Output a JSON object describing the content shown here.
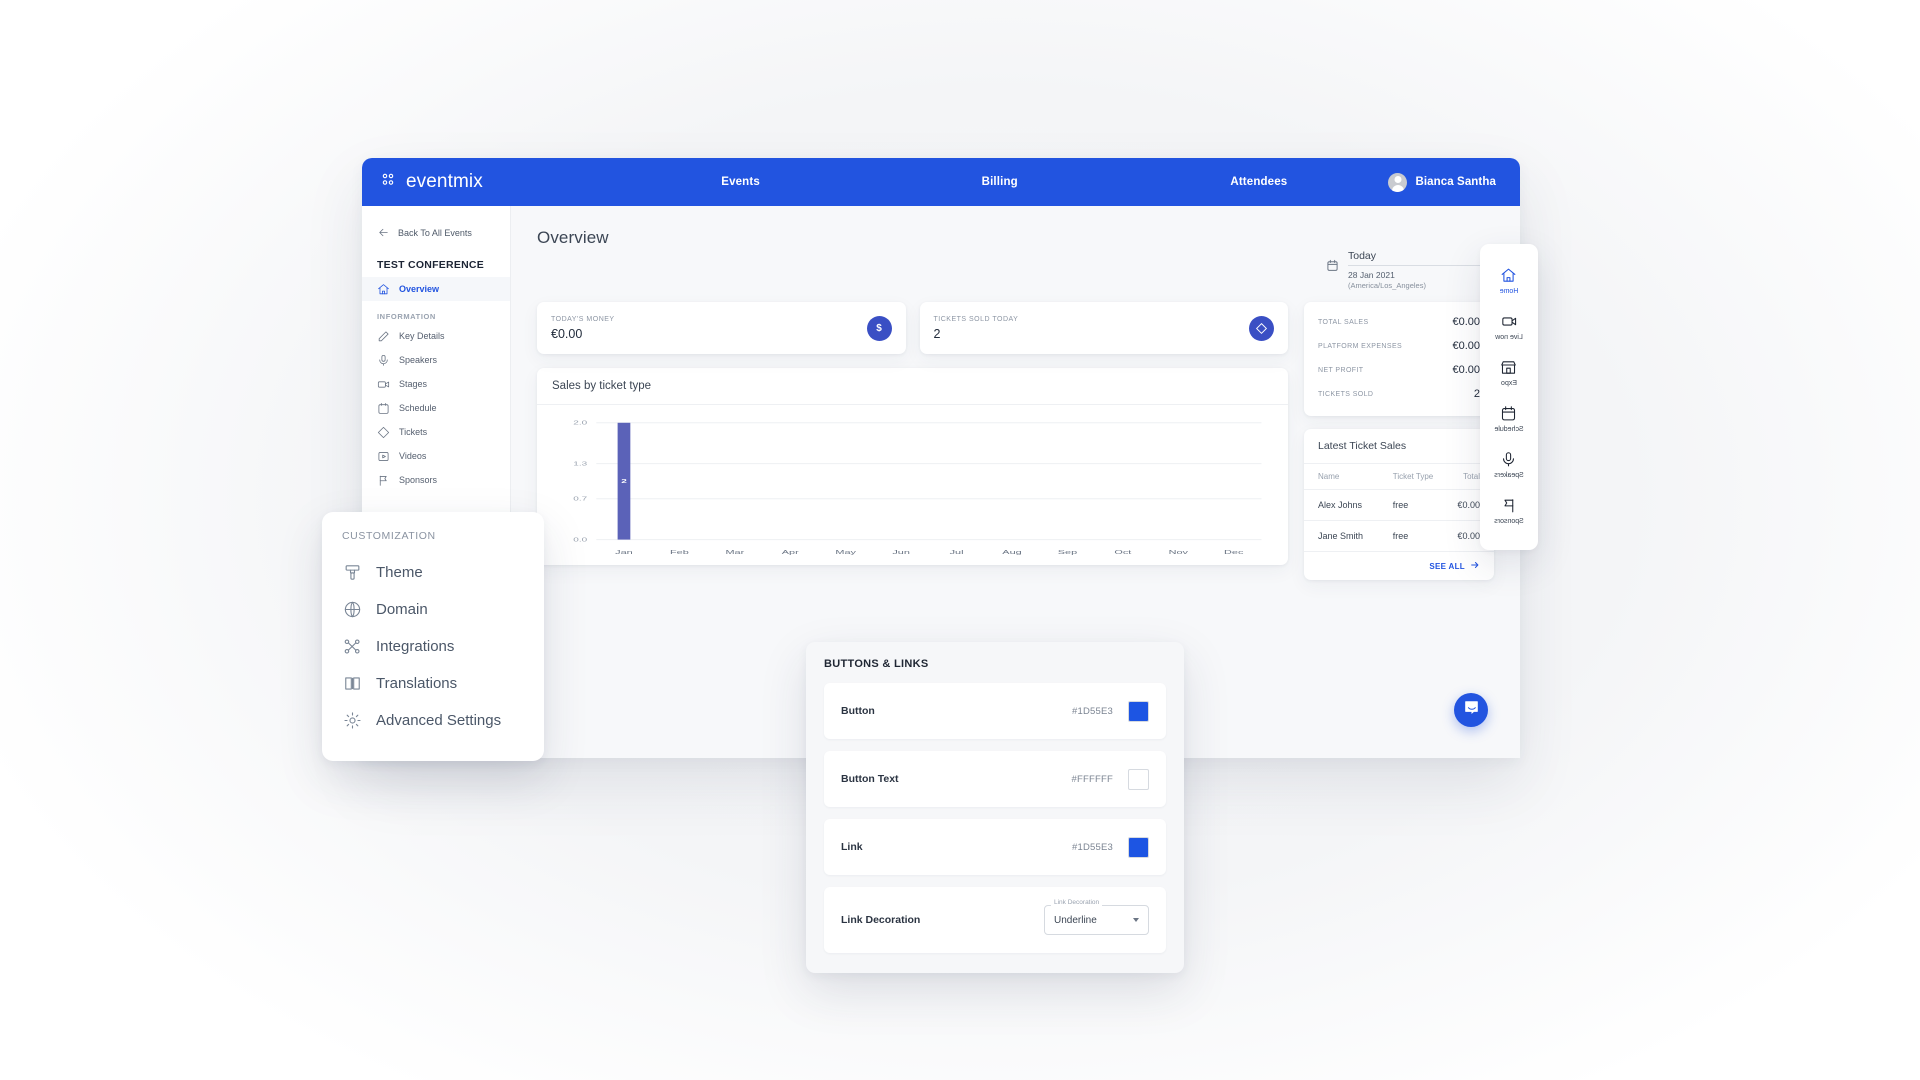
{
  "header": {
    "logo_text": "eventmix",
    "logo_icon": "grid-dots-icon",
    "nav": [
      {
        "label": "Events"
      },
      {
        "label": "Billing"
      },
      {
        "label": "Attendees"
      }
    ],
    "user": {
      "name": "Bianca Santha",
      "avatar_icon": "user-avatar-icon"
    },
    "accent_color": "#2254E0"
  },
  "sidebar": {
    "back_label": "Back To All Events",
    "event_name": "TEST CONFERENCE",
    "primary": [
      {
        "label": "Overview",
        "icon": "home-icon",
        "active": true
      }
    ],
    "group_label": "INFORMATION",
    "items": [
      {
        "label": "Key Details",
        "icon": "pencil-icon"
      },
      {
        "label": "Speakers",
        "icon": "microphone-icon"
      },
      {
        "label": "Stages",
        "icon": "video-camera-icon"
      },
      {
        "label": "Schedule",
        "icon": "calendar-icon"
      },
      {
        "label": "Tickets",
        "icon": "ticket-icon"
      },
      {
        "label": "Videos",
        "icon": "video-play-icon"
      },
      {
        "label": "Sponsors",
        "icon": "flag-icon"
      }
    ]
  },
  "main": {
    "page_title": "Overview",
    "date_picker": {
      "icon": "calendar-icon",
      "selected": "Today",
      "date": "28 Jan 2021",
      "timezone": "(America/Los_Angeles)",
      "caret_icon": "chevron-down-icon"
    },
    "kpis": [
      {
        "label": "TODAY'S MONEY",
        "value": "€0.00",
        "badge_icon": "dollar-icon",
        "badge_glyph": "$"
      },
      {
        "label": "TICKETS SOLD TODAY",
        "value": "2",
        "badge_icon": "ticket-icon",
        "badge_glyph": ""
      }
    ],
    "chart_card_title": "Sales by ticket type",
    "stats": [
      {
        "label": "TOTAL SALES",
        "value": "€0.00"
      },
      {
        "label": "PLATFORM EXPENSES",
        "value": "€0.00"
      },
      {
        "label": "NET PROFIT",
        "value": "€0.00"
      },
      {
        "label": "TICKETS SOLD",
        "value": "2"
      }
    ],
    "latest_sales": {
      "title": "Latest Ticket Sales",
      "columns": [
        "Name",
        "Ticket Type",
        "Total"
      ],
      "rows": [
        {
          "name": "Alex Johns",
          "type": "free",
          "total": "€0.00"
        },
        {
          "name": "Jane Smith",
          "type": "free",
          "total": "€0.00"
        }
      ],
      "see_all_label": "SEE ALL",
      "see_all_icon": "arrow-right-icon"
    }
  },
  "chart_data": {
    "type": "bar",
    "title": "Sales by ticket type",
    "categories": [
      "Jan",
      "Feb",
      "Mar",
      "Apr",
      "May",
      "Jun",
      "Jul",
      "Aug",
      "Sep",
      "Oct",
      "Nov",
      "Dec"
    ],
    "values": [
      2,
      0,
      0,
      0,
      0,
      0,
      0,
      0,
      0,
      0,
      0,
      0
    ],
    "bar_labels": [
      "2",
      "",
      "",
      "",
      "",
      "",
      "",
      "",
      "",
      "",
      "",
      ""
    ],
    "yticks": [
      "0.0",
      "0.7",
      "1.3",
      "2.0"
    ],
    "ylim": [
      0,
      2
    ],
    "xlabel": "",
    "ylabel": "",
    "grid": true,
    "legend": false,
    "series_color": "#5b62b8"
  },
  "customization_panel": {
    "title": "CUSTOMIZATION",
    "items": [
      {
        "label": "Theme",
        "icon": "paint-brush-icon"
      },
      {
        "label": "Domain",
        "icon": "globe-icon"
      },
      {
        "label": "Integrations",
        "icon": "integrations-nodes-icon"
      },
      {
        "label": "Translations",
        "icon": "book-icon"
      },
      {
        "label": "Advanced Settings",
        "icon": "gear-icon"
      }
    ]
  },
  "buttons_links_panel": {
    "title": "BUTTONS & LINKS",
    "rows": [
      {
        "name": "Button",
        "hex": "#1D55E3",
        "swatch": "#1D55E3",
        "kind": "color"
      },
      {
        "name": "Button Text",
        "hex": "#FFFFFF",
        "swatch": "#FFFFFF",
        "kind": "color"
      },
      {
        "name": "Link",
        "hex": "#1D55E3",
        "swatch": "#1D55E3",
        "kind": "color"
      }
    ],
    "decoration_row": {
      "name": "Link Decoration",
      "field_legend": "Link Decoration",
      "value": "Underline",
      "caret_icon": "chevron-down-icon"
    }
  },
  "attendee_nav": {
    "items": [
      {
        "label": "Home",
        "icon": "home-icon",
        "active": true
      },
      {
        "label": "Live now",
        "icon": "video-camera-icon"
      },
      {
        "label": "Expo",
        "icon": "storefront-icon"
      },
      {
        "label": "Schedule",
        "icon": "calendar-icon"
      },
      {
        "label": "Speakers",
        "icon": "microphone-icon"
      },
      {
        "label": "Sponsors",
        "icon": "flag-icon"
      }
    ]
  },
  "intercom": {
    "icon": "chat-bubble-icon"
  }
}
